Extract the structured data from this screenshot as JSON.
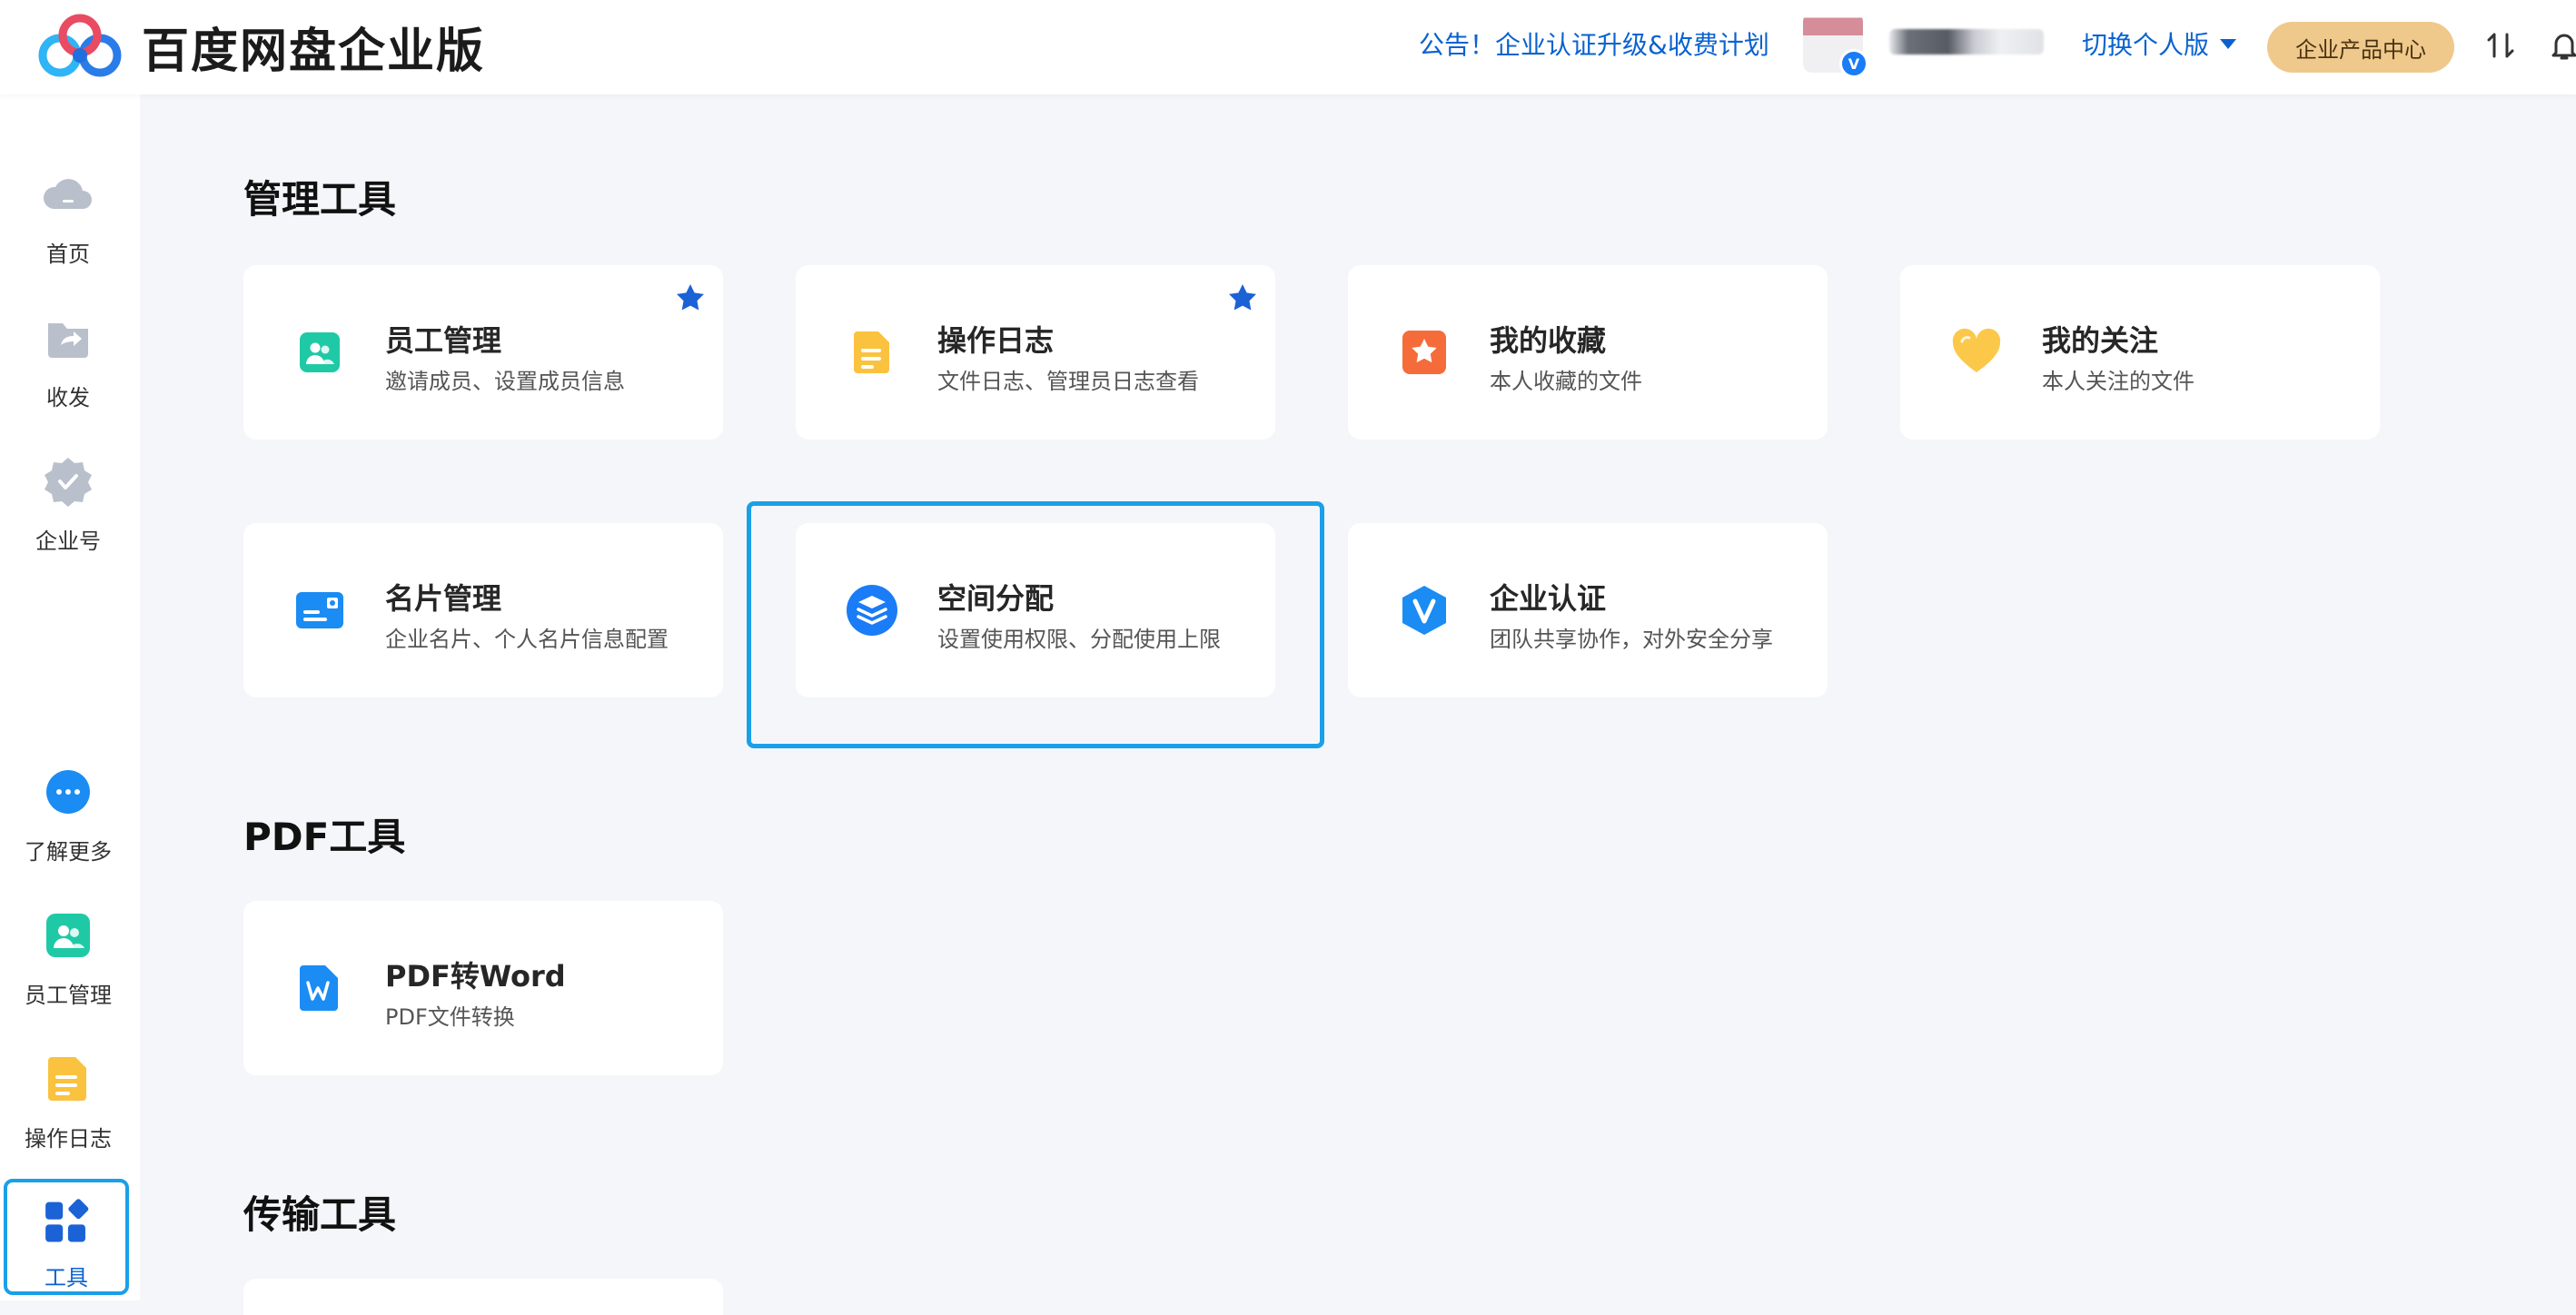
{
  "header": {
    "brand_title": "百度网盘企业版",
    "notice": "公告！企业认证升级&收费计划",
    "switch_label": "切换个人版",
    "product_center": "企业产品中心"
  },
  "sidebar": {
    "items": [
      {
        "label": "首页",
        "icon": "cloud-icon"
      },
      {
        "label": "收发",
        "icon": "share-folder-icon"
      },
      {
        "label": "企业号",
        "icon": "verified-badge-icon"
      },
      {
        "label": "了解更多",
        "icon": "more-icon"
      },
      {
        "label": "员工管理",
        "icon": "staff-icon"
      },
      {
        "label": "操作日志",
        "icon": "log-icon"
      },
      {
        "label": "工具",
        "icon": "tools-icon",
        "active": true
      }
    ]
  },
  "sections": {
    "manage": {
      "title": "管理工具",
      "cards": [
        {
          "title": "员工管理",
          "desc": "邀请成员、设置成员信息",
          "icon": "staff-icon",
          "starred": true
        },
        {
          "title": "操作日志",
          "desc": "文件日志、管理员日志查看",
          "icon": "log-icon",
          "starred": true
        },
        {
          "title": "我的收藏",
          "desc": "本人收藏的文件",
          "icon": "favorite-icon"
        },
        {
          "title": "我的关注",
          "desc": "本人关注的文件",
          "icon": "heart-icon"
        },
        {
          "title": "名片管理",
          "desc": "企业名片、个人名片信息配置",
          "icon": "card-icon"
        },
        {
          "title": "空间分配",
          "desc": "设置使用权限、分配使用上限",
          "icon": "layers-icon"
        },
        {
          "title": "企业认证",
          "desc": "团队共享协作，对外安全分享",
          "icon": "verify-v-icon"
        }
      ]
    },
    "pdf": {
      "title": "PDF工具",
      "cards": [
        {
          "title": "PDF转Word",
          "desc": "PDF文件转换",
          "icon": "pdf-word-icon"
        }
      ]
    },
    "transfer": {
      "title": "传输工具"
    }
  },
  "colors": {
    "accent": "#0a62d0",
    "highlight": "#1aa0e8",
    "product_button": "#efc98b",
    "page_bg": "#f5f6f9"
  }
}
